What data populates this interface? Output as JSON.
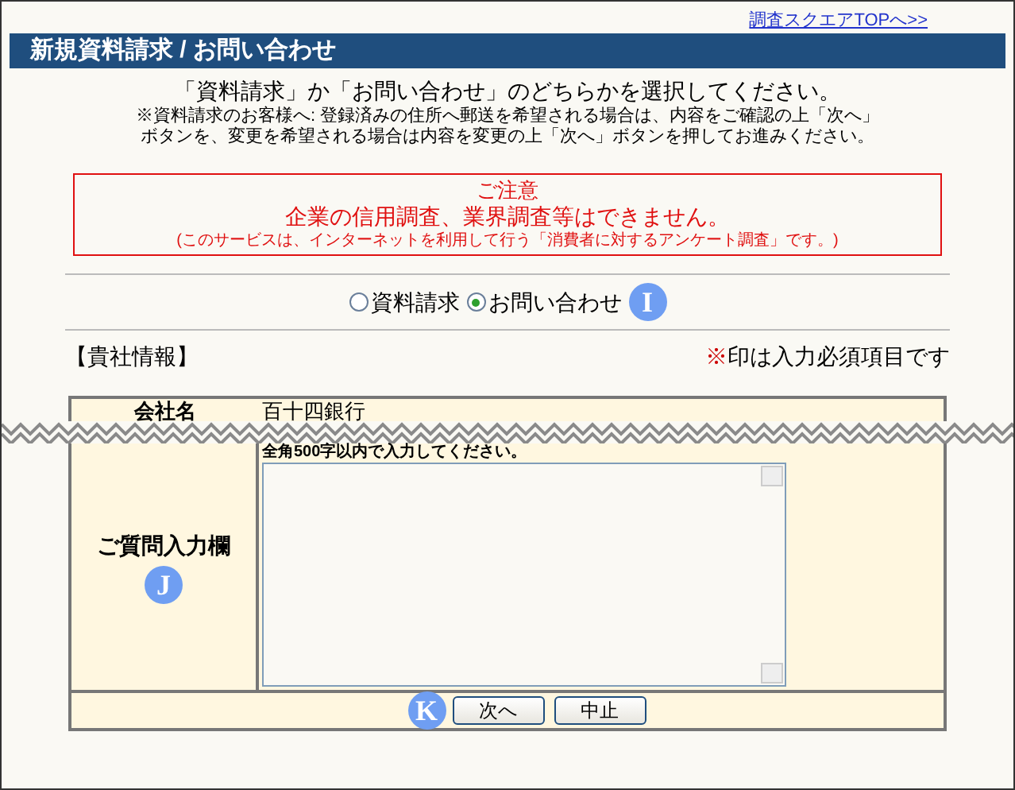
{
  "top_link": "調査スクエアTOPへ>>",
  "title": "新規資料請求 / お問い合わせ",
  "intro": {
    "main": "「資料請求」か「お問い合わせ」のどちらかを選択してください。",
    "note_1": "※資料請求のお客様へ: 登録済みの住所へ郵送を希望される場合は、内容をご確認の上「次へ」",
    "note_2": "ボタンを、変更を希望される場合は内容を変更の上「次へ」ボタンを押してお進みください。"
  },
  "notice": {
    "heading": "ご注意",
    "main": "企業の信用調査、業界調査等はできません。",
    "sub": "(このサービスは、インターネットを利用して行う「消費者に対するアンケート調査」です。)"
  },
  "radios": [
    {
      "label": "資料請求",
      "selected": false
    },
    {
      "label": "お問い合わせ",
      "selected": true
    }
  ],
  "radio_marker": "I",
  "section_label": "【貴社情報】",
  "required_note": {
    "mark": "※",
    "text": "印は入力必須項目です"
  },
  "company_row": {
    "label": "会社名",
    "value": "百十四銀行"
  },
  "question_row": {
    "label": "ご質問入力欄",
    "marker": "J",
    "hint": "全角500字以内で入力してください。"
  },
  "buttons_marker": "K",
  "buttons": [
    "次へ",
    "中止"
  ]
}
